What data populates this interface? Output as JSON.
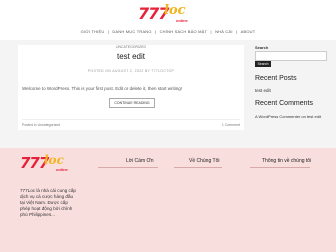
{
  "header": {
    "logo": {
      "num": "777",
      "loc": "loc",
      "tag": "online"
    },
    "nav": [
      "GIỚI THIỆU",
      "|",
      "DANH MỤC TRANG",
      "|",
      "CHÍNH SÁCH BẢO MẬT",
      "|",
      "NHÀ CÁI",
      "|",
      "ABOUT"
    ]
  },
  "post": {
    "category": "UNCATEGORIZED",
    "title": "test edit",
    "meta": "POSTED ON AUGUST 2, 2022 BY 777LOCTOP",
    "excerpt": "Welcome to WordPress. This is your first post. Edit or delete it, then start writing!",
    "read_more": "CONTINUE READING",
    "posted_in": "Posted in Uncategorized",
    "comments": "1 Comment"
  },
  "sidebar": {
    "search_label": "Search",
    "search_button": "Search",
    "recent_posts_title": "Recent Posts",
    "recent_posts": [
      "test edit"
    ],
    "recent_comments_title": "Recent Comments",
    "recent_comment": "A WordPress Commenter on test edit"
  },
  "footer": {
    "logo": {
      "num": "777",
      "loc": "loc",
      "tag": "online"
    },
    "about_text": "777Loc là nhà cái cung cấp dịch vụ cá cược hàng đầu tại Việt Nam. Được cấp phép hoạt động bởi chính phủ Philippines...",
    "col1": "Lời Cám Ơn",
    "col2": "Về Chúng Tôi",
    "col3": "Thông tin về chúng tôi"
  }
}
